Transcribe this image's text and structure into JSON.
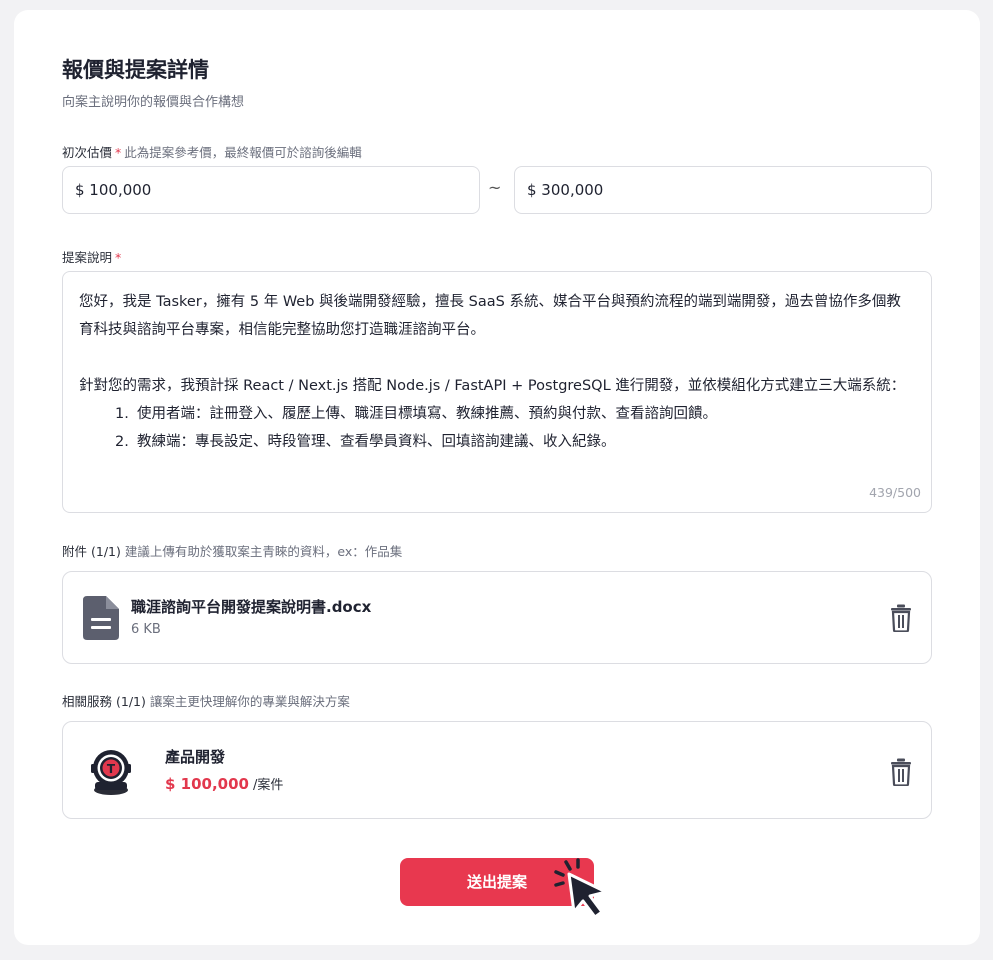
{
  "section": {
    "title": "報價與提案詳情",
    "subtitle": "向案主說明你的報價與合作構想"
  },
  "estimate": {
    "label": "初次估價",
    "required_mark": "*",
    "hint": "此為提案參考價，最終報價可於諮詢後編輯",
    "min_value": "$ 100,000",
    "separator": "~",
    "max_value": "$ 300,000"
  },
  "proposal": {
    "label": "提案說明",
    "required_mark": "*",
    "paragraph1": "您好，我是 Tasker，擁有 5 年 Web 與後端開發經驗，擅長 SaaS 系統、媒合平台與預約流程的端到端開發，過去曾協作多個教育科技與諮詢平台專案，相信能完整協助您打造職涯諮詢平台。",
    "paragraph2": "針對您的需求，我預計採 React / Next.js 搭配 Node.js / FastAPI + PostgreSQL 進行開發，並依模組化方式建立三大端系統：",
    "list": [
      {
        "num": "1.",
        "text": "使用者端：註冊登入、履歷上傳、職涯目標填寫、教練推薦、預約與付款、查看諮詢回饋。"
      },
      {
        "num": "2.",
        "text": "教練端：專長設定、時段管理、查看學員資料、回填諮詢建議、收入紀錄。"
      }
    ],
    "char_count": "439/500"
  },
  "attachments": {
    "label": "附件",
    "count": "(1/1)",
    "hint": "建議上傳有助於獲取案主青睞的資料，ex：作品集",
    "file": {
      "name": "職涯諮詢平台開發提案說明書.docx",
      "size": "6 KB",
      "icon": "document-icon"
    }
  },
  "services": {
    "label": "相關服務",
    "count": "(1/1)",
    "hint": "讓案主更快理解你的專業與解決方案",
    "item": {
      "name": "產品開發",
      "price": "$ 100,000",
      "unit": "/案件",
      "avatar_letter": "T"
    }
  },
  "submit_label": "送出提案",
  "colors": {
    "accent": "#e8384f",
    "text": "#1f2230",
    "muted": "#6b6f7d",
    "border": "#dcdde2"
  }
}
